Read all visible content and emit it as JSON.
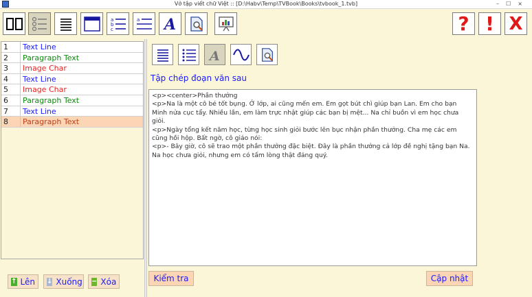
{
  "window": {
    "title": "Vở tập viết chữ Việt :: [D:\\Habv\\Temp\\TVBook\\Books\\tvbook_1.tvb]",
    "controls": [
      "–",
      "☐",
      "×"
    ]
  },
  "toolbar": {
    "items": [
      {
        "name": "two-pages-icon"
      },
      {
        "name": "outline-list-icon"
      },
      {
        "name": "lines-icon"
      },
      {
        "name": "header-page-icon"
      },
      {
        "name": "numbered-list-icon"
      },
      {
        "name": "bullet-lines-icon"
      },
      {
        "name": "script-a-icon"
      },
      {
        "name": "page-search-icon"
      },
      {
        "name": "presentation-chart-icon"
      },
      {
        "name": "help-icon"
      },
      {
        "name": "alert-icon"
      },
      {
        "name": "close-icon"
      }
    ],
    "help_label": "?",
    "alert_label": "!",
    "close_label": "X"
  },
  "items": [
    {
      "num": "1",
      "label": "Text Line",
      "kind": "text"
    },
    {
      "num": "2",
      "label": "Paragraph Text",
      "kind": "para"
    },
    {
      "num": "3",
      "label": "Image Char",
      "kind": "img"
    },
    {
      "num": "4",
      "label": "Text Line",
      "kind": "text"
    },
    {
      "num": "5",
      "label": "Image Char",
      "kind": "img"
    },
    {
      "num": "6",
      "label": "Paragraph Text",
      "kind": "para"
    },
    {
      "num": "7",
      "label": "Text Line",
      "kind": "text"
    },
    {
      "num": "8",
      "label": "Paragraph Text",
      "kind": "sel"
    }
  ],
  "left_buttons": {
    "up": "Lên",
    "down": "Xuống",
    "delete": "Xóa"
  },
  "editor": {
    "heading": "Tập chép đoạn văn sau",
    "lines": [
      "<p><center>Phần thưởng",
      "<p>Na là một cô bé tốt bụng. Ở lớp, ai cũng mến em. Em gọt bút chì giúp bạn Lan. Em cho bạn Minh nửa cục tẩy. Nhiều lần, em làm trực nhật giúp các bạn bị mệt... Na chỉ buồn vì em học chưa giỏi.",
      "<p>Ngày tổng kết năm học, từng học sinh giỏi bước lên bục nhận phần thưởng. Cha mẹ các em cũng hồi hộp. Bất ngờ, cô giáo nói:",
      "<p>- Bây giờ, cô sẽ trao một phần thưởng đặc biệt. Đây là phần thưởng cả lớp đề nghị tặng bạn Na. Na học chưa giỏi, nhưng em có tấm lòng thật đáng quý."
    ],
    "check_button": "Kiểm tra",
    "update_button": "Cập nhật"
  },
  "colors": {
    "background": "#fbf6d8",
    "text_line": "#1a1aff",
    "paragraph_text": "#0b8a0b",
    "image_char": "#f02020",
    "selected_row": "#fbd5b4"
  }
}
